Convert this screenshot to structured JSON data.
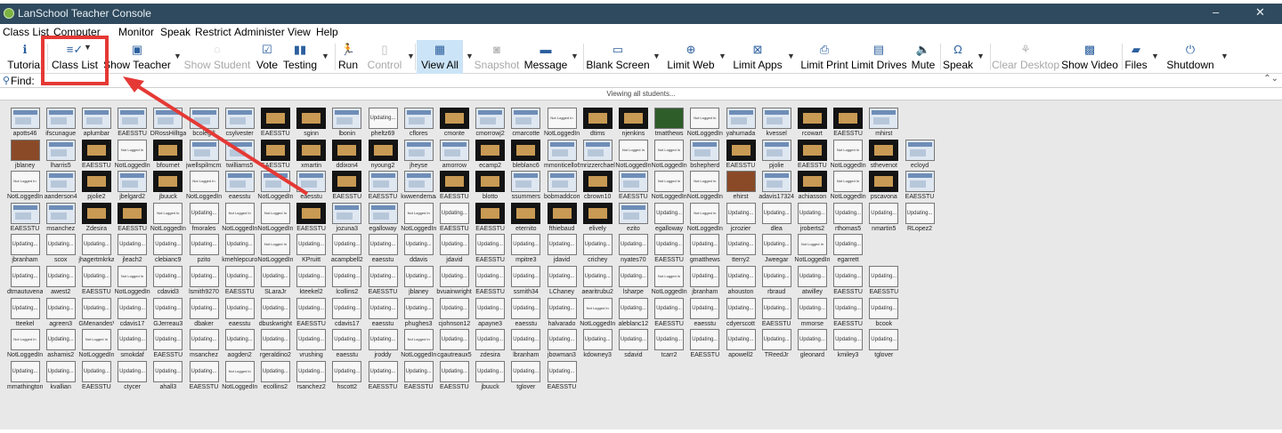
{
  "window": {
    "title": "LanSchool Teacher Console",
    "minimize_glyph": "–",
    "close_glyph": "✕"
  },
  "menu": [
    "Class List",
    "Computer",
    "Monitor",
    "Speak",
    "Restrict",
    "Administer",
    "View",
    "Help"
  ],
  "toolbar": [
    {
      "label": "Tutorial",
      "icon": "info-icon",
      "glyph": "ℹ",
      "disabled": false
    },
    {
      "label": "Class List",
      "icon": "class-list-icon",
      "glyph": "≡✓",
      "disabled": false,
      "dropdown": true,
      "highlighted": true
    },
    {
      "label": "Show Teacher",
      "icon": "show-teacher-icon",
      "glyph": "▣",
      "disabled": false,
      "dropdown": true
    },
    {
      "label": "Show Student",
      "icon": "show-student-icon",
      "glyph": "◌",
      "disabled": true
    },
    {
      "label": "Vote",
      "icon": "vote-icon",
      "glyph": "☑",
      "disabled": false
    },
    {
      "label": "Testing",
      "icon": "testing-icon",
      "glyph": "▮▮",
      "disabled": false,
      "dropdown": true
    },
    {
      "label": "Run",
      "icon": "run-icon",
      "glyph": "🏃",
      "disabled": false
    },
    {
      "label": "Control",
      "icon": "control-icon",
      "glyph": "▯",
      "disabled": true,
      "dropdown": true
    },
    {
      "label": "View All",
      "icon": "view-all-icon",
      "glyph": "▦",
      "disabled": false,
      "dropdown": true,
      "selected": true
    },
    {
      "label": "Snapshot",
      "icon": "camera-icon",
      "glyph": "◙",
      "disabled": true
    },
    {
      "label": "Message",
      "icon": "message-icon",
      "glyph": "▬",
      "disabled": false,
      "dropdown": true
    },
    {
      "label": "Blank Screen",
      "icon": "monitor-icon",
      "glyph": "▭",
      "disabled": false,
      "dropdown": true
    },
    {
      "label": "Limit Web",
      "icon": "globe-icon",
      "glyph": "⊕",
      "disabled": false,
      "dropdown": true
    },
    {
      "label": "Limit Apps",
      "icon": "limit-apps-icon",
      "glyph": "⊠",
      "disabled": false,
      "dropdown": true
    },
    {
      "label": "Limit Print",
      "icon": "printer-icon",
      "glyph": "⎙",
      "disabled": false
    },
    {
      "label": "Limit Drives",
      "icon": "drive-icon",
      "glyph": "▤",
      "disabled": false
    },
    {
      "label": "Mute",
      "icon": "speaker-icon",
      "glyph": "🔈",
      "disabled": false
    },
    {
      "label": "Speak",
      "icon": "headset-icon",
      "glyph": "Ω",
      "disabled": false,
      "dropdown": true
    },
    {
      "label": "Clear Desktop",
      "icon": "broom-icon",
      "glyph": "⚘",
      "disabled": true
    },
    {
      "label": "Show Video",
      "icon": "clapper-icon",
      "glyph": "▩",
      "disabled": false
    },
    {
      "label": "Files",
      "icon": "folder-icon",
      "glyph": "▰",
      "disabled": false,
      "dropdown": true
    },
    {
      "label": "Shutdown",
      "icon": "power-icon",
      "glyph": "⏻",
      "disabled": false,
      "dropdown": true
    }
  ],
  "find": {
    "label": "Find:",
    "placeholder": ""
  },
  "status": "Viewing all students...",
  "thumb_texts": {
    "updating": "Updating...",
    "not_logged_in": "Not Logged In"
  },
  "students": [
    [
      "apotts46",
      "s",
      "shot"
    ],
    [
      "ifscunague",
      "s",
      "shot"
    ],
    [
      "aplumbar",
      "s",
      "shot"
    ],
    [
      "EAESSTU",
      "s",
      "shot"
    ],
    [
      "DRossHilltgar",
      "s",
      "shot"
    ],
    [
      "bcolegill",
      "s",
      "shot"
    ],
    [
      "csylvester",
      "s",
      "shot"
    ],
    [
      "EAESSTU",
      "s",
      "dark"
    ],
    [
      "sginn",
      "s",
      "dark"
    ],
    [
      "lbonin",
      "s",
      "shot"
    ],
    [
      "pheltz69",
      "u",
      ""
    ],
    [
      "cflores",
      "s",
      "shot"
    ],
    [
      "cmonte",
      "s",
      "dark"
    ],
    [
      "cmorrowj2",
      "s",
      "shot"
    ],
    [
      "cmarcotte",
      "s",
      "shot"
    ],
    [
      "NotLoggedIn",
      "u",
      ""
    ],
    [
      "dtims",
      "s",
      "dark"
    ],
    [
      "njenkins",
      "s",
      "dark"
    ],
    [
      "tmatthews",
      "s",
      "green"
    ],
    [
      "NotLoggedIn",
      "u",
      ""
    ],
    [
      "yahumada",
      "s",
      "shot"
    ],
    [
      "kvessel",
      "s",
      "shot"
    ],
    [
      "rcowart",
      "s",
      "dark"
    ],
    [
      "EAESSTU",
      "s",
      "dark"
    ],
    [
      "mhirst",
      "s",
      "shot"
    ],
    [
      "jblaney",
      "s",
      "photo"
    ],
    [
      "lharris5",
      "s",
      "shot"
    ],
    [
      "EAESSTU",
      "s",
      "dark"
    ],
    [
      "NotLoggedIn",
      "u",
      ""
    ],
    [
      "bfournet",
      "s",
      "dark"
    ],
    [
      "jwellspilmcm2",
      "s",
      "shot"
    ],
    [
      "twilliams5",
      "s",
      "shot"
    ],
    [
      "EAESSTU",
      "s",
      "dark"
    ],
    [
      "xmartin",
      "s",
      "dark"
    ],
    [
      "ddixon4",
      "s",
      "dark"
    ],
    [
      "nyoung2",
      "s",
      "dark"
    ],
    [
      "jheyse",
      "s",
      "shot"
    ],
    [
      "amorrow",
      "s",
      "shot"
    ],
    [
      "ecamp2",
      "s",
      "dark"
    ],
    [
      "bleblanc6",
      "s",
      "dark"
    ],
    [
      "mmonticello6e",
      "s",
      "shot"
    ],
    [
      "mrizzerchaelo",
      "s",
      "shot"
    ],
    [
      "NotLoggedIn",
      "u",
      ""
    ],
    [
      "NotLoggedIn",
      "u",
      ""
    ],
    [
      "bshepherd",
      "s",
      "shot"
    ],
    [
      "EAESSTU",
      "s",
      "dark"
    ],
    [
      "pjolie",
      "s",
      "shot"
    ],
    [
      "EAESSTU",
      "s",
      "dark"
    ],
    [
      "NotLoggedIn",
      "u",
      ""
    ],
    [
      "sthevenot",
      "s",
      "dark"
    ],
    [
      "ecloyd",
      "s",
      "shot"
    ],
    [
      "NotLoggedIn",
      "u",
      ""
    ],
    [
      "aanderson4",
      "s",
      "shot"
    ],
    [
      "pjolie2",
      "s",
      "dark"
    ],
    [
      "jbelgard2",
      "s",
      "shot"
    ],
    [
      "jbuuck",
      "s",
      "dark"
    ],
    [
      "NotLoggedIn",
      "u",
      ""
    ],
    [
      "eaesstu",
      "s",
      "shot"
    ],
    [
      "NotLoggedIn",
      "s",
      "shot"
    ],
    [
      "eaesstu",
      "s",
      "shot"
    ],
    [
      "EAESSTU",
      "s",
      "dark"
    ],
    [
      "EAESSTU",
      "s",
      "shot"
    ],
    [
      "kwwendemaad",
      "s",
      "shot"
    ],
    [
      "EAESSTU",
      "s",
      "dark"
    ],
    [
      "blotto",
      "s",
      "dark"
    ],
    [
      "ssummers",
      "s",
      "shot"
    ],
    [
      "bobmaddcom",
      "s",
      "shot"
    ],
    [
      "cbrown10",
      "s",
      "dark"
    ],
    [
      "EAESSTU",
      "s",
      "shot"
    ],
    [
      "NotLoggedIn",
      "u",
      ""
    ],
    [
      "NotLoggedIn",
      "u",
      ""
    ],
    [
      "ehirst",
      "s",
      "photo"
    ],
    [
      "adavis17324",
      "s",
      "shot"
    ],
    [
      "achiasson",
      "s",
      "dark"
    ],
    [
      "NotLoggedIn",
      "u",
      ""
    ],
    [
      "pscavona",
      "s",
      "dark"
    ],
    [
      "EAESSTU",
      "s",
      "shot"
    ],
    [
      "EAESSTU",
      "s",
      "shot"
    ],
    [
      "msanchez",
      "s",
      "shot"
    ],
    [
      "Zdesira",
      "s",
      "dark"
    ],
    [
      "EAESSTU",
      "s",
      "dark"
    ],
    [
      "NotLoggedIn",
      "u",
      ""
    ],
    [
      "fmorales",
      "u",
      ""
    ],
    [
      "NotLoggedIn",
      "u",
      ""
    ],
    [
      "NotLoggedIn",
      "u",
      ""
    ],
    [
      "EAESSTU",
      "s",
      "dark"
    ],
    [
      "jozuna3",
      "s",
      "shot"
    ],
    [
      "egalloway",
      "s",
      "shot"
    ],
    [
      "NotLoggedIn",
      "u",
      ""
    ],
    [
      "EAESSTU",
      "u",
      ""
    ],
    [
      "EAESSTU",
      "s",
      "dark"
    ],
    [
      "eternito",
      "s",
      "dark"
    ],
    [
      "fthiebaud",
      "s",
      "dark"
    ],
    [
      "elively",
      "s",
      "dark"
    ],
    [
      "ezito",
      "s",
      "shot"
    ],
    [
      "egalloway",
      "u",
      ""
    ],
    [
      "NotLoggedIn",
      "u",
      ""
    ],
    [
      "jcrozier",
      "u",
      ""
    ],
    [
      "dlea",
      "u",
      ""
    ],
    [
      "jroberts2",
      "u",
      ""
    ],
    [
      "rthomas5",
      "u",
      ""
    ],
    [
      "nmartin5",
      "u",
      ""
    ],
    [
      "RLopez2",
      "u",
      ""
    ],
    [
      "jbranham",
      "u",
      ""
    ],
    [
      "scox",
      "u",
      ""
    ],
    [
      "jhagertmkrkam",
      "u",
      ""
    ],
    [
      "jleach2",
      "u",
      ""
    ],
    [
      "clebianc9",
      "u",
      ""
    ],
    [
      "pzito",
      "u",
      ""
    ],
    [
      "kmehlepcurocm",
      "u",
      ""
    ],
    [
      "NotLoggedIn",
      "u",
      ""
    ],
    [
      "KPruitt",
      "u",
      ""
    ],
    [
      "acampbell2",
      "u",
      ""
    ],
    [
      "eaesstu",
      "u",
      ""
    ],
    [
      "ddavis",
      "u",
      ""
    ],
    [
      "jdavid",
      "u",
      ""
    ],
    [
      "EAESSTU",
      "u",
      ""
    ],
    [
      "mpitre3",
      "u",
      ""
    ],
    [
      "jdavid",
      "u",
      ""
    ],
    [
      "crichey",
      "u",
      ""
    ],
    [
      "nyates70",
      "u",
      ""
    ],
    [
      "EAESSTU",
      "u",
      ""
    ],
    [
      "gmatthews",
      "u",
      ""
    ],
    [
      "tterry2",
      "u",
      ""
    ],
    [
      "Jweegar",
      "u",
      ""
    ],
    [
      "NotLoggedIn",
      "u",
      ""
    ],
    [
      "egarrett",
      "u",
      ""
    ],
    [
      "dtmautuvena",
      "u",
      ""
    ],
    [
      "awest2",
      "u",
      ""
    ],
    [
      "EAESSTU",
      "u",
      ""
    ],
    [
      "NotLoggedIn",
      "u",
      ""
    ],
    [
      "cdavid3",
      "u",
      ""
    ],
    [
      "lsmith9270",
      "u",
      ""
    ],
    [
      "EAESSTU",
      "u",
      ""
    ],
    [
      "SLaraJr",
      "u",
      ""
    ],
    [
      "kteekel2",
      "u",
      ""
    ],
    [
      "lcollins2",
      "u",
      ""
    ],
    [
      "EAESSTU",
      "u",
      ""
    ],
    [
      "jblaney",
      "u",
      ""
    ],
    [
      "bvuainwright2",
      "u",
      ""
    ],
    [
      "EAESSTU",
      "u",
      ""
    ],
    [
      "ssmith34",
      "u",
      ""
    ],
    [
      "LChaney",
      "u",
      ""
    ],
    [
      "aearitrubu2",
      "u",
      ""
    ],
    [
      "lsharpe",
      "u",
      ""
    ],
    [
      "NotLoggedIn",
      "u",
      ""
    ],
    [
      "jbranham",
      "u",
      ""
    ],
    [
      "ahouston",
      "u",
      ""
    ],
    [
      "rbraud",
      "u",
      ""
    ],
    [
      "atwilley",
      "u",
      ""
    ],
    [
      "EAESSTU",
      "u",
      ""
    ],
    [
      "EAESSTU",
      "u",
      ""
    ],
    [
      "tteekel",
      "u",
      ""
    ],
    [
      "agreen3",
      "u",
      ""
    ],
    [
      "GMenandesV",
      "u",
      ""
    ],
    [
      "cdavis17",
      "u",
      ""
    ],
    [
      "GJerreau3",
      "u",
      ""
    ],
    [
      "dbaker",
      "u",
      ""
    ],
    [
      "eaesstu",
      "u",
      ""
    ],
    [
      "dbuskwright",
      "u",
      ""
    ],
    [
      "EAESSTU",
      "u",
      ""
    ],
    [
      "cdavis17",
      "u",
      ""
    ],
    [
      "eaesstu",
      "u",
      ""
    ],
    [
      "phughes3",
      "u",
      ""
    ],
    [
      "cjohnson12",
      "u",
      ""
    ],
    [
      "apayne3",
      "u",
      ""
    ],
    [
      "eaesstu",
      "u",
      ""
    ],
    [
      "halvarado",
      "u",
      ""
    ],
    [
      "NotLoggedIn",
      "u",
      ""
    ],
    [
      "aleblanc12",
      "u",
      ""
    ],
    [
      "EAESSTU",
      "u",
      ""
    ],
    [
      "eaesstu",
      "u",
      ""
    ],
    [
      "cdyerscott",
      "u",
      ""
    ],
    [
      "EAESSTU",
      "u",
      ""
    ],
    [
      "mmorse",
      "u",
      ""
    ],
    [
      "EAESSTU",
      "u",
      ""
    ],
    [
      "bcook",
      "u",
      ""
    ],
    [
      "NotLoggedIn",
      "u",
      ""
    ],
    [
      "ashamis2",
      "u",
      ""
    ],
    [
      "NotLoggedIn",
      "u",
      ""
    ],
    [
      "smokdaf",
      "u",
      ""
    ],
    [
      "EAESSTU",
      "u",
      ""
    ],
    [
      "msanchez",
      "u",
      ""
    ],
    [
      "aogden2",
      "u",
      ""
    ],
    [
      "rgeraldino2",
      "u",
      ""
    ],
    [
      "vrushing",
      "u",
      ""
    ],
    [
      "eaesstu",
      "u",
      ""
    ],
    [
      "jroddy",
      "u",
      ""
    ],
    [
      "NotLoggedIn",
      "u",
      ""
    ],
    [
      "cgautreaux5",
      "u",
      ""
    ],
    [
      "zdesira",
      "u",
      ""
    ],
    [
      "lbranham",
      "u",
      ""
    ],
    [
      "jbowman3",
      "u",
      ""
    ],
    [
      "kdowney3",
      "u",
      ""
    ],
    [
      "sdavid",
      "u",
      ""
    ],
    [
      "tcarr2",
      "u",
      ""
    ],
    [
      "EAESSTU",
      "u",
      ""
    ],
    [
      "apowell2",
      "u",
      ""
    ],
    [
      "TReedJr",
      "u",
      ""
    ],
    [
      "gleonard",
      "u",
      ""
    ],
    [
      "kmiley3",
      "u",
      ""
    ],
    [
      "tglover",
      "u",
      ""
    ],
    [
      "mmathington2",
      "u",
      ""
    ],
    [
      "kvallian",
      "u",
      ""
    ],
    [
      "EAESSTU",
      "u",
      ""
    ],
    [
      "ctycer",
      "u",
      ""
    ],
    [
      "ahall3",
      "u",
      ""
    ],
    [
      "EAESSTU",
      "u",
      ""
    ],
    [
      "NotLoggedIn",
      "u",
      ""
    ],
    [
      "ecollins2",
      "u",
      ""
    ],
    [
      "rsanchez2",
      "u",
      ""
    ],
    [
      "hscott2",
      "u",
      ""
    ],
    [
      "EAESSTU",
      "u",
      ""
    ],
    [
      "EAESSTU",
      "u",
      ""
    ],
    [
      "EAESSTU",
      "u",
      ""
    ],
    [
      "jbuuck",
      "u",
      ""
    ],
    [
      "tglover",
      "u",
      ""
    ],
    [
      "EAESSTU",
      "u",
      ""
    ]
  ]
}
